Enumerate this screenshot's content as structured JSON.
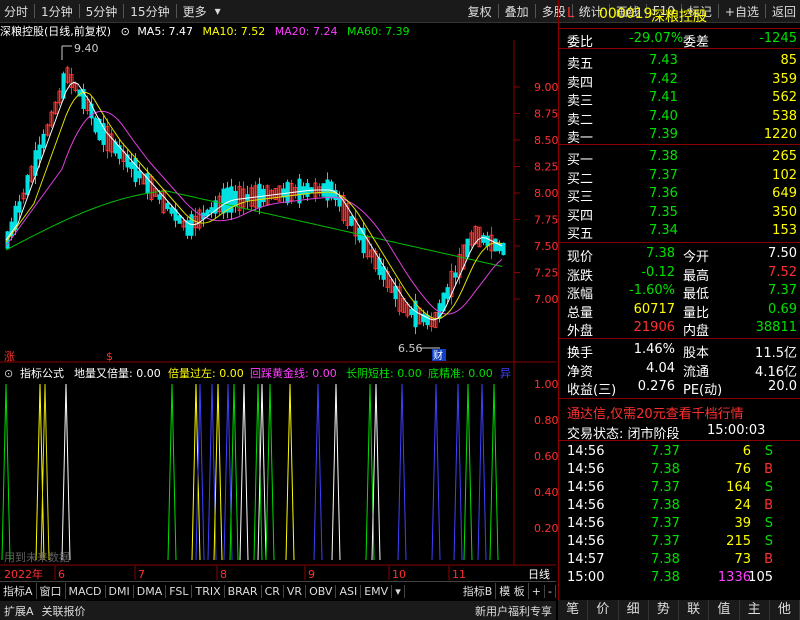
{
  "toolbar": {
    "left_items": [
      "分时",
      "1分钟",
      "5分钟",
      "15分钟",
      "更多"
    ],
    "right_items": [
      "复权",
      "叠加",
      "多股",
      "统计",
      "画线",
      "F10",
      "标记",
      "+自选",
      "返回"
    ]
  },
  "chart_header": {
    "stock_label": "深粮控股(日线,前复权)",
    "ma5": "MA5: 7.47",
    "ma10": "MA10: 7.52",
    "ma20": "MA20: 7.24",
    "ma60": "MA60: 7.39"
  },
  "indicator_header": {
    "title": "指标公式",
    "items": [
      "地量又倍量: 0.00",
      "倍量过左: 0.00",
      "回踩黄金线: 0.00",
      "长阴短柱: 0.00",
      "底精准: 0.00"
    ],
    "tag": "异"
  },
  "price_axis": [
    "9.00",
    "8.75",
    "8.50",
    "8.25",
    "8.00",
    "7.75",
    "7.50",
    "7.25",
    "7.00"
  ],
  "indicator_axis": [
    "1.00",
    "0.80",
    "0.60",
    "0.40",
    "0.20"
  ],
  "annotations": {
    "high": "9.40",
    "low": "6.56",
    "zhang": "涨",
    "dollar": "$",
    "cai": "财",
    "future_note": "用到未来数据"
  },
  "date_axis": {
    "year": "2022年",
    "months": [
      "6",
      "7",
      "8",
      "9",
      "10",
      "11"
    ],
    "right": "日线"
  },
  "tabs": [
    "指标A",
    "窗口",
    "MACD",
    "DMI",
    "DMA",
    "FSL",
    "TRIX",
    "BRAR",
    "CR",
    "VR",
    "OBV",
    "ASI",
    "EMV",
    "▾"
  ],
  "tabs_right": [
    "指标B",
    "模 板",
    "+",
    "-"
  ],
  "status": {
    "left": [
      "扩展A",
      "关联报价"
    ],
    "right": "新用户福利专享"
  },
  "quote": {
    "code_prefix": "L",
    "code": "000019",
    "name": "深粮控股",
    "weibi_label": "委比",
    "weibi": "-29.07%",
    "weicha_label": "委差",
    "weicha": "-1245",
    "sells": [
      {
        "label": "卖五",
        "price": "7.43",
        "vol": "85"
      },
      {
        "label": "卖四",
        "price": "7.42",
        "vol": "359"
      },
      {
        "label": "卖三",
        "price": "7.41",
        "vol": "562"
      },
      {
        "label": "卖二",
        "price": "7.40",
        "vol": "538"
      },
      {
        "label": "卖一",
        "price": "7.39",
        "vol": "1220"
      }
    ],
    "buys": [
      {
        "label": "买一",
        "price": "7.38",
        "vol": "265"
      },
      {
        "label": "买二",
        "price": "7.37",
        "vol": "102"
      },
      {
        "label": "买三",
        "price": "7.36",
        "vol": "649"
      },
      {
        "label": "买四",
        "price": "7.35",
        "vol": "350"
      },
      {
        "label": "买五",
        "price": "7.34",
        "vol": "153"
      }
    ],
    "stats": [
      {
        "l1": "现价",
        "v1": "7.38",
        "l2": "今开",
        "v2": "7.50"
      },
      {
        "l1": "涨跌",
        "v1": "-0.12",
        "l2": "最高",
        "v2": "7.52"
      },
      {
        "l1": "涨幅",
        "v1": "-1.60%",
        "l2": "最低",
        "v2": "7.37"
      },
      {
        "l1": "总量",
        "v1": "60717",
        "l2": "量比",
        "v2": "0.69"
      },
      {
        "l1": "外盘",
        "v1": "21906",
        "l2": "内盘",
        "v2": "38811"
      }
    ],
    "stats2": [
      {
        "l1": "换手",
        "v1": "1.46%",
        "l2": "股本",
        "v2": "11.5亿"
      },
      {
        "l1": "净资",
        "v1": "4.04",
        "l2": "流通",
        "v2": "4.16亿"
      },
      {
        "l1": "收益(三)",
        "v1": "0.276",
        "l2": "PE(动)",
        "v2": "20.0"
      }
    ],
    "promo": "通达信,仅需20元查看千档行情",
    "trade_status_label": "交易状态: 闭市阶段",
    "trade_status_time": "15:00:03",
    "ticks": [
      {
        "t": "14:56",
        "p": "7.37",
        "v": "6",
        "s": "S"
      },
      {
        "t": "14:56",
        "p": "7.38",
        "v": "76",
        "s": "B"
      },
      {
        "t": "14:56",
        "p": "7.37",
        "v": "164",
        "s": "S"
      },
      {
        "t": "14:56",
        "p": "7.38",
        "v": "24",
        "s": "B"
      },
      {
        "t": "14:56",
        "p": "7.37",
        "v": "39",
        "s": "S"
      },
      {
        "t": "14:56",
        "p": "7.37",
        "v": "215",
        "s": "S"
      },
      {
        "t": "14:57",
        "p": "7.38",
        "v": "73",
        "s": "B"
      },
      {
        "t": "15:00",
        "p": "7.38",
        "v": "1336",
        "s": "105"
      }
    ],
    "bottom_tabs": [
      "笔",
      "价",
      "细",
      "势",
      "联",
      "值",
      "主",
      "他"
    ]
  }
}
